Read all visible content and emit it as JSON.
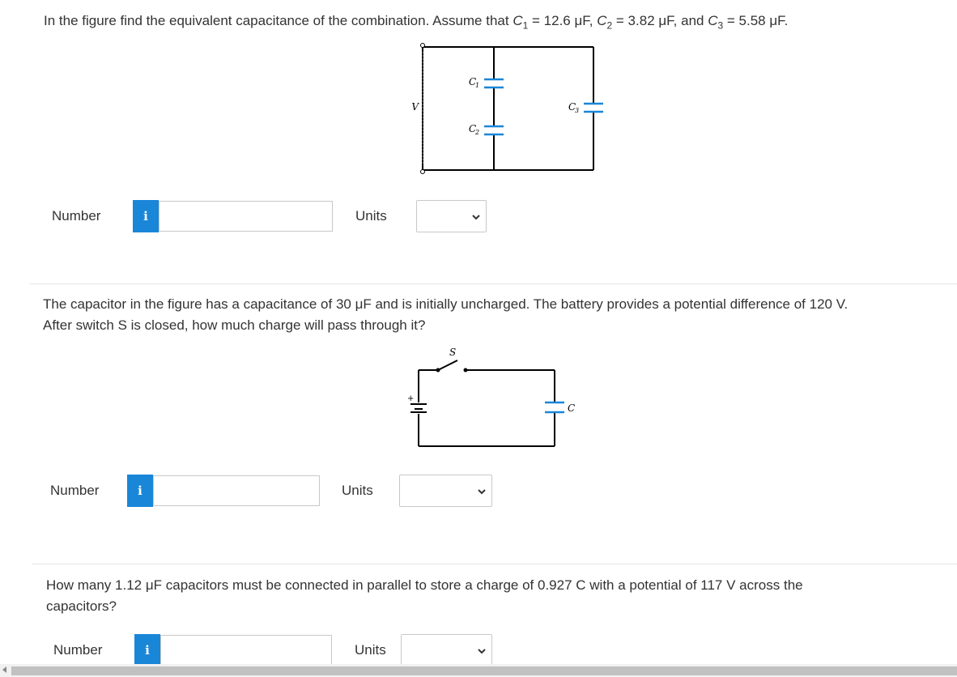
{
  "q1": {
    "prefix": "In the figure find the equivalent capacitance of the combination. Assume that ",
    "c1_sym": "C",
    "c1_sub": "1",
    "c1_val": " = 12.6 μF, ",
    "c2_sym": "C",
    "c2_sub": "2",
    "c2_val": " = 3.82 μF, and ",
    "c3_sym": "C",
    "c3_sub": "3",
    "c3_val": " = 5.58 μF.",
    "figure": {
      "c1": "C",
      "c1s": "1",
      "c2": "C",
      "c2s": "2",
      "c3": "C",
      "c3s": "3",
      "v": "V"
    },
    "number_label": "Number",
    "info_icon": "i",
    "number_value": "",
    "units_label": "Units",
    "units_selected": ""
  },
  "q2": {
    "text_line1": "The capacitor in the figure has a capacitance of 30 μF and is initially uncharged. The battery provides a potential difference of 120 V.",
    "text_line2": "After switch S is closed, how much charge will pass through it?",
    "figure": {
      "s": "S",
      "c": "C",
      "plus": "+"
    },
    "number_label": "Number",
    "info_icon": "i",
    "number_value": "",
    "units_label": "Units",
    "units_selected": ""
  },
  "q3": {
    "text_line1": "How many 1.12 μF capacitors must be connected in parallel to store a charge of 0.927 C with a potential of 117 V across the",
    "text_line2": "capacitors?",
    "number_label": "Number",
    "info_icon": "i",
    "number_value": "",
    "units_label": "Units",
    "units_selected": ""
  },
  "colors": {
    "info_blue": "#1a86d8",
    "text": "#333333",
    "border": "#c8c8c8"
  }
}
